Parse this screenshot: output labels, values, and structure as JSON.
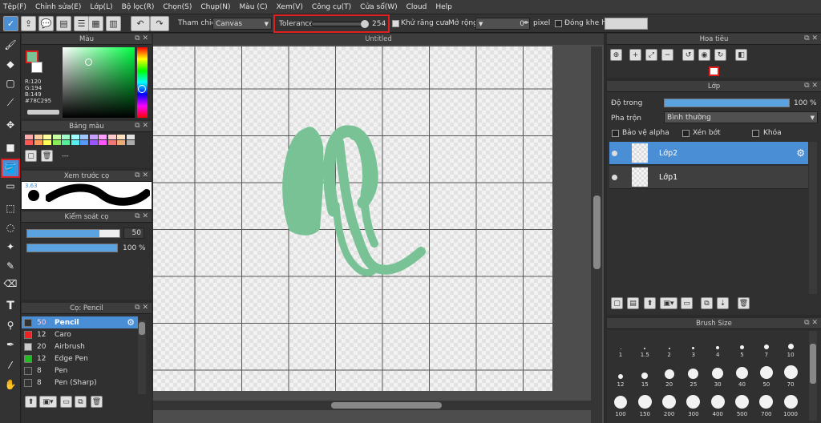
{
  "menu": [
    "Tệp(F)",
    "Chỉnh sửa(E)",
    "Lớp(L)",
    "Bộ lọc(R)",
    "Chọn(S)",
    "Chụp(N)",
    "Màu (C)",
    "Xem(V)",
    "Công cụ(T)",
    "Cửa sổ(W)",
    "Cloud",
    "Help"
  ],
  "toolbar": {
    "reference_label": "Tham chiếu",
    "reference_value": "Canvas",
    "tolerance_label": "Tolerance",
    "tolerance_value": "254",
    "tolerance_fraction": 0.99,
    "antialias_label": "Khử răng cưa",
    "expand_label": "Mở rộng",
    "expand_value": "0",
    "expand_unit": "pixel",
    "close_gap_label": "Đóng khe hở"
  },
  "color_panel": {
    "title": "Màu",
    "r": "R:120",
    "g": "G:194",
    "b": "B:149",
    "hex": "#78C295",
    "current_color": "#78c295"
  },
  "palette_panel": {
    "title": "Bảng màu",
    "dash": "---",
    "swatches": [
      "#ffaaaa",
      "#ffd0a0",
      "#ffffa0",
      "#c8ffa0",
      "#a0ffc8",
      "#a0ffff",
      "#a0c8ff",
      "#c8a0ff",
      "#ffa0ff",
      "#ffcccc",
      "#ffe0c0",
      "#e0e0e0",
      "#ff5555",
      "#ff9955",
      "#ffff55",
      "#88ee55",
      "#55ee99",
      "#55eeee",
      "#5599ff",
      "#9955ff",
      "#ff55ff",
      "#ee7777",
      "#eeaa77",
      "#aaaaaa"
    ]
  },
  "preview_panel": {
    "title": "Xem trước cọ",
    "size": "3.63"
  },
  "brush_control": {
    "title": "Kiểm soát cọ",
    "size_value": "50",
    "size_fraction": 0.78,
    "opacity_value": "100 %",
    "opacity_fraction": 1.0
  },
  "brush_list": {
    "title": "Cọ: Pencil",
    "items": [
      {
        "size": "50",
        "name": "Pencil",
        "color": "#333333"
      },
      {
        "size": "12",
        "name": "Caro",
        "color": "#ee2222"
      },
      {
        "size": "20",
        "name": "Airbrush",
        "color": "#cccccc"
      },
      {
        "size": "12",
        "name": "Edge Pen",
        "color": "#22bb22"
      },
      {
        "size": "8",
        "name": "Pen",
        "color": "#333333"
      },
      {
        "size": "8",
        "name": "Pen (Sharp)",
        "color": "#333333"
      }
    ]
  },
  "document": {
    "title": "Untitled",
    "stroke_color": "#78c295"
  },
  "navigator": {
    "title": "Hoa tiêu"
  },
  "layers_panel": {
    "title": "Lớp",
    "opacity_label": "Độ trong",
    "opacity_value": "100 %",
    "opacity_fraction": 1.0,
    "blend_label": "Pha trộn",
    "blend_value": "Bình thường",
    "protect_alpha": "Bảo vệ alpha",
    "clipping": "Xén bớt",
    "lock": "Khóa",
    "layers": [
      {
        "name": "Lớp2",
        "selected": true
      },
      {
        "name": "Lớp1",
        "selected": false
      }
    ]
  },
  "brush_size": {
    "title": "Brush Size",
    "sizes": [
      "1",
      "1.5",
      "2",
      "3",
      "4",
      "5",
      "7",
      "10",
      "12",
      "15",
      "20",
      "25",
      "30",
      "40",
      "50",
      "70",
      "100",
      "150",
      "200",
      "300",
      "400",
      "500",
      "700",
      "1000"
    ]
  }
}
